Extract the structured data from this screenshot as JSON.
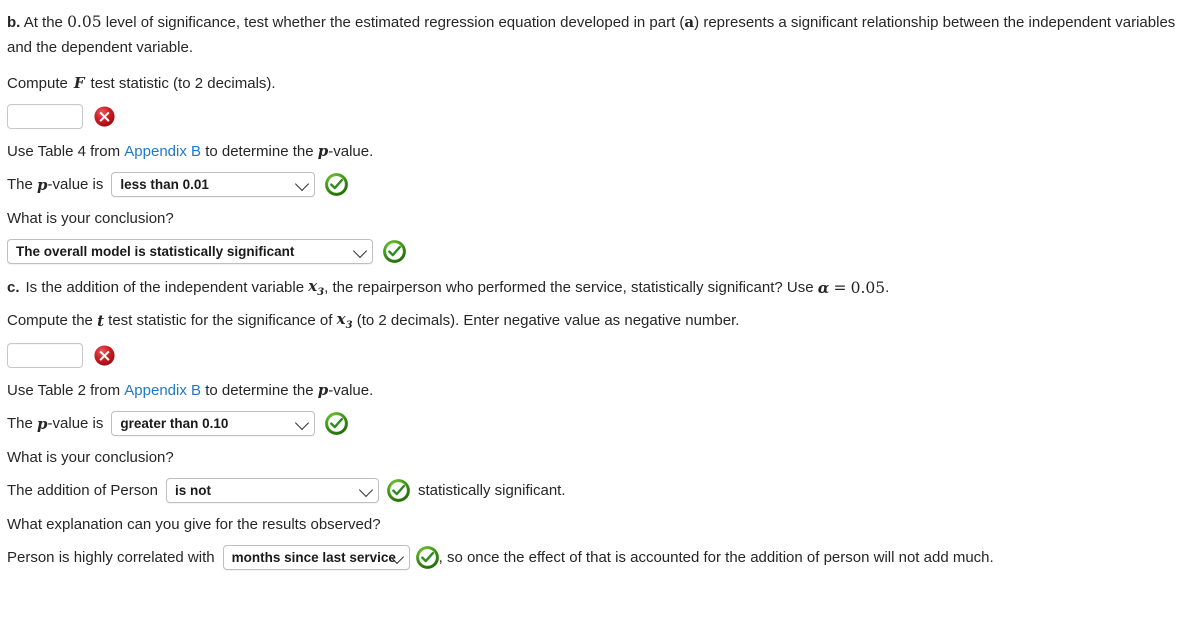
{
  "part_b": {
    "label": "b.",
    "prompt_1": "At the",
    "alpha_value": "0.05",
    "prompt_2": "level of significance, test whether the estimated regression equation developed in part (",
    "part_ref": "a",
    "prompt_3": ") represents a significant relationship between the independent variables and the dependent variable.",
    "compute_prefix": "Compute",
    "compute_symbol": "F",
    "compute_suffix": "test statistic (to 2 decimals).",
    "answer_value": "",
    "answer_placeholder": "",
    "answer_status": "incorrect",
    "table_text_1": "Use Table 4 from",
    "appendix_link": "Appendix B",
    "table_text_2": "to determine the",
    "pvalue_symbol": "p",
    "table_text_3": "-value.",
    "pvalue_label_1": "The",
    "pvalue_label_2": "-value is",
    "pvalue_selected": "less than 0.01",
    "pvalue_status": "correct",
    "conclusion_question": "What is your conclusion?",
    "conclusion_selected": "The overall model is statistically significant",
    "conclusion_status": "correct"
  },
  "part_c": {
    "label": "c.",
    "prompt_1": "Is the addition of the independent variable",
    "var_symbol": "x",
    "var_sub": "3",
    "prompt_2": ", the repairperson who performed the service, statistically significant? Use",
    "alpha_symbol": "α",
    "alpha_eq": "=",
    "alpha_value": "0.05",
    "prompt_3": ".",
    "compute_prefix": "Compute the",
    "compute_symbol": "t",
    "compute_mid": "test statistic for the significance of",
    "compute_suffix": "(to 2 decimals). Enter negative value as negative number.",
    "answer_value": "",
    "answer_placeholder": "",
    "answer_status": "incorrect",
    "table_text_1": "Use Table 2 from",
    "appendix_link": "Appendix B",
    "table_text_2": "to determine the",
    "pvalue_symbol": "p",
    "table_text_3": "-value.",
    "pvalue_label_1": "The",
    "pvalue_label_2": "-value is",
    "pvalue_selected": "greater than 0.10",
    "pvalue_status": "correct",
    "conclusion_question": "What is your conclusion?",
    "addition_prefix": "The addition of Person",
    "addition_selected": "is not",
    "addition_status": "correct",
    "addition_suffix": "statistically significant.",
    "explanation_question": "What explanation can you give for the results observed?",
    "explanation_prefix": "Person is highly correlated with",
    "explanation_selected": "months since last service",
    "explanation_status": "correct",
    "explanation_suffix": ", so once the effect of that is accounted for the addition of person will not add much."
  },
  "colors": {
    "link": "#2079c7",
    "correct": "#2e8b1f",
    "incorrect": "#c42026",
    "text": "#262626"
  }
}
